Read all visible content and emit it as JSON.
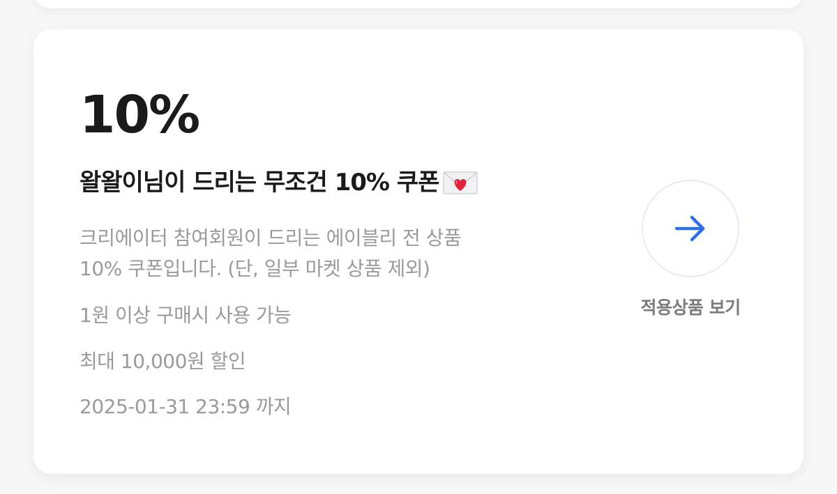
{
  "coupon": {
    "discount": "10%",
    "title": "왈왈이님이 드리는 무조건 10% 쿠폰",
    "title_emoji_icon": "love-letter-icon",
    "description_lines": [
      "크리에이터 참여회원이 드리는 에이블리 전 상품",
      "10% 쿠폰입니다. (단, 일부 마켓 상품 제외)"
    ],
    "min_purchase": "1원 이상 구매시 사용 가능",
    "max_discount": "최대 10,000원 할인",
    "expiry": "2025-01-31 23:59 까지"
  },
  "action": {
    "icon": "arrow-right-icon",
    "label": "적용상품 보기",
    "accent_color": "#2f6fe4"
  }
}
